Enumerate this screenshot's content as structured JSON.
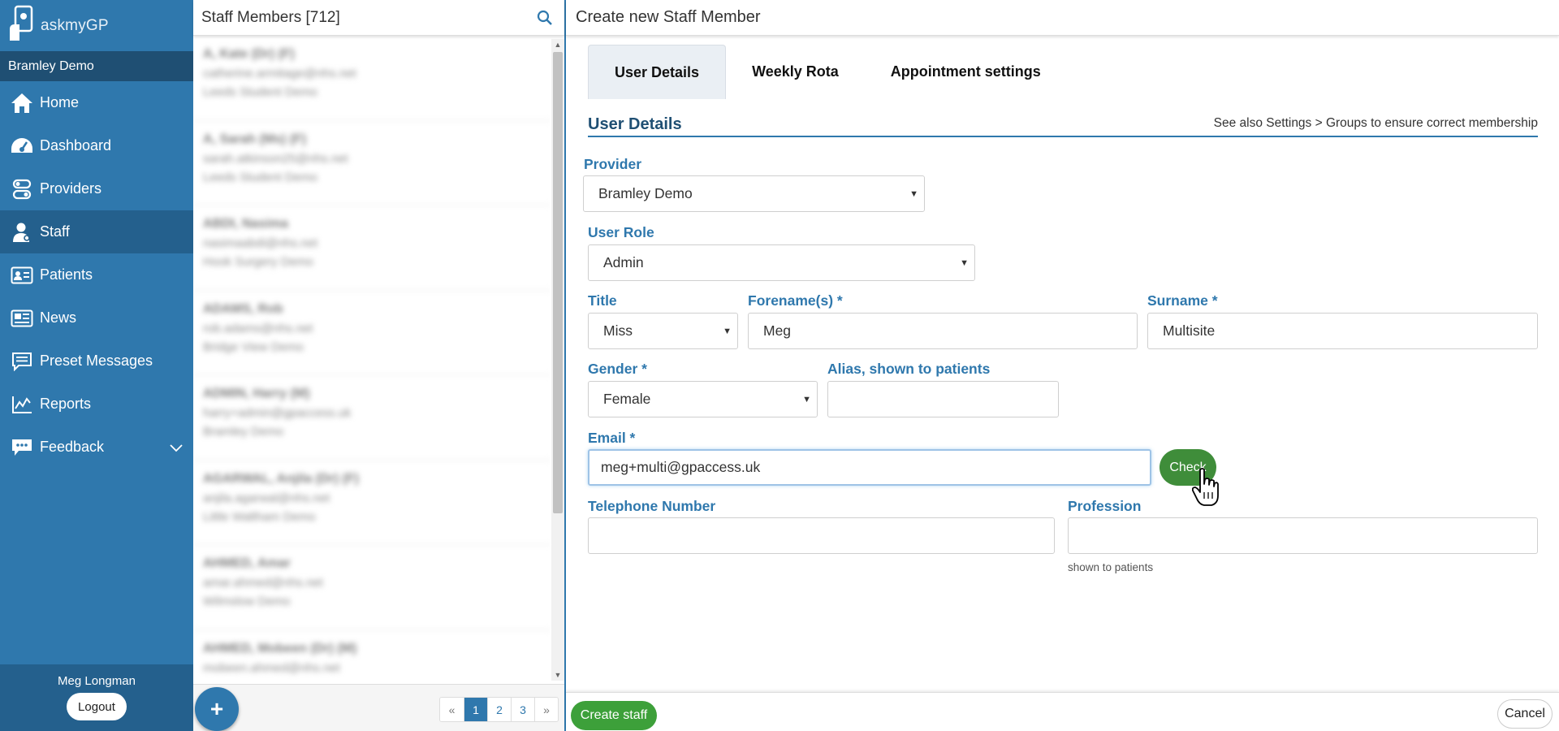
{
  "app": {
    "logo_text": "askmyGP",
    "practice": "Bramley Demo"
  },
  "sidebar": {
    "items": [
      {
        "label": "Home",
        "icon": "home-icon"
      },
      {
        "label": "Dashboard",
        "icon": "dashboard-icon"
      },
      {
        "label": "Providers",
        "icon": "providers-icon"
      },
      {
        "label": "Staff",
        "icon": "staff-icon",
        "active": true
      },
      {
        "label": "Patients",
        "icon": "patients-icon"
      },
      {
        "label": "News",
        "icon": "news-icon"
      },
      {
        "label": "Preset Messages",
        "icon": "messages-icon"
      },
      {
        "label": "Reports",
        "icon": "reports-icon"
      },
      {
        "label": "Feedback",
        "icon": "feedback-icon"
      }
    ],
    "user_name": "Meg Longman",
    "logout_label": "Logout"
  },
  "staff_list": {
    "title": "Staff Members [712]",
    "items": [
      {
        "name": "A, Kate (Dr) (F)",
        "email": "catherine.armitage@nhs.net",
        "practice": "Leeds Student Demo"
      },
      {
        "name": "A, Sarah (Ms) (F)",
        "email": "sarah.atkinson25@nhs.net",
        "practice": "Leeds Student Demo"
      },
      {
        "name": "ABDI, Nasima",
        "email": "nasimaabdi@nhs.net",
        "practice": "Hook Surgery Demo"
      },
      {
        "name": "ADAMS, Rob",
        "email": "rob.adams@nhs.net",
        "practice": "Bridge View Demo"
      },
      {
        "name": "ADMIN, Harry (M)",
        "email": "harry+admin@gpaccess.uk",
        "practice": "Bramley Demo"
      },
      {
        "name": "AGARWAL, Anjila (Dr) (F)",
        "email": "anjila.agarwal@nhs.net",
        "practice": "Little Waltham Demo"
      },
      {
        "name": "AHMED, Amar",
        "email": "amar.ahmed@nhs.net",
        "practice": "Wilmslow Demo"
      },
      {
        "name": "AHMED, Mobeen (Dr) (M)",
        "email": "mobeen.ahmed@nhs.net",
        "practice": ""
      }
    ],
    "add_label": "+",
    "pager": {
      "prev": "«",
      "pages": [
        "1",
        "2",
        "3"
      ],
      "current": "1",
      "next": "»"
    }
  },
  "form": {
    "header": "Create new Staff Member",
    "tabs": [
      "User Details",
      "Weekly Rota",
      "Appointment settings"
    ],
    "active_tab": "User Details",
    "section_title": "User Details",
    "section_note": "See also Settings > Groups to ensure correct membership",
    "provider": {
      "label": "Provider",
      "value": "Bramley Demo"
    },
    "user_role": {
      "label": "User Role",
      "value": "Admin"
    },
    "title": {
      "label": "Title",
      "value": "Miss"
    },
    "forename": {
      "label": "Forename(s) *",
      "value": "Meg"
    },
    "surname": {
      "label": "Surname *",
      "value": "Multisite"
    },
    "gender": {
      "label": "Gender *",
      "value": "Female"
    },
    "alias": {
      "label": "Alias, shown to patients",
      "value": ""
    },
    "email": {
      "label": "Email *",
      "value": "meg+multi@gpaccess.uk"
    },
    "check_label": "Check",
    "telephone": {
      "label": "Telephone Number",
      "value": ""
    },
    "profession": {
      "label": "Profession",
      "value": "",
      "hint": "shown to patients"
    },
    "create_label": "Create staff",
    "cancel_label": "Cancel"
  },
  "colors": {
    "sidebar": "#2f78ad",
    "sidebar_dark": "#1f4f73",
    "label": "#2f78ad",
    "success": "#3da03a"
  }
}
